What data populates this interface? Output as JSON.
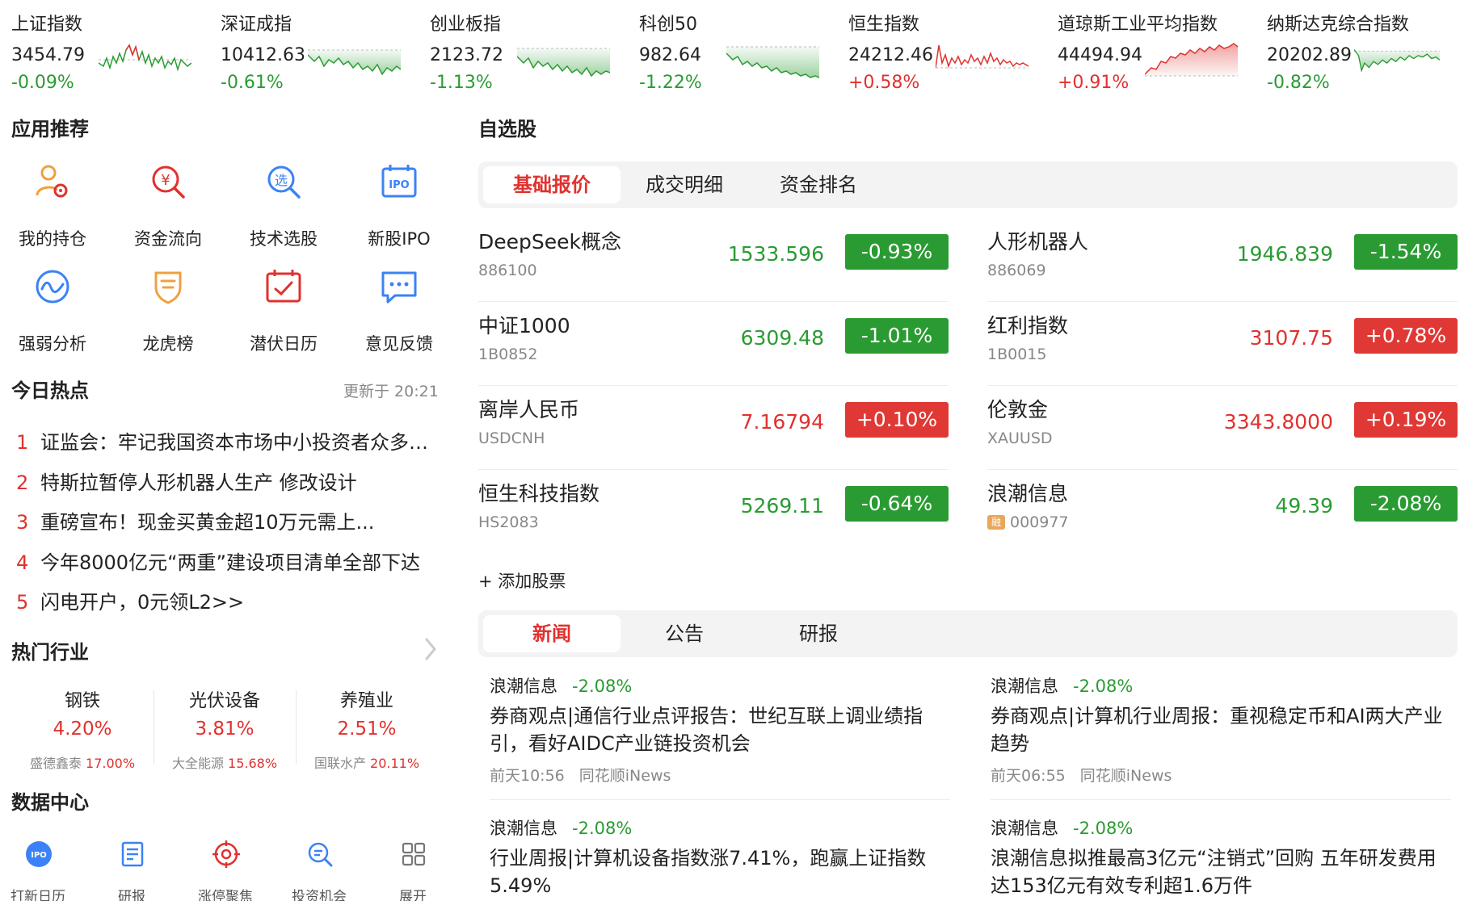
{
  "tickers": [
    {
      "name": "上证指数",
      "value": "3454.79",
      "change": "-0.09%",
      "dir": "down"
    },
    {
      "name": "深证成指",
      "value": "10412.63",
      "change": "-0.61%",
      "dir": "down"
    },
    {
      "name": "创业板指",
      "value": "2123.72",
      "change": "-1.13%",
      "dir": "down"
    },
    {
      "name": "科创50",
      "value": "982.64",
      "change": "-1.22%",
      "dir": "down"
    },
    {
      "name": "恒生指数",
      "value": "24212.46",
      "change": "+0.58%",
      "dir": "up"
    },
    {
      "name": "道琼斯工业平均指数",
      "value": "44494.94",
      "change": "+0.91%",
      "dir": "up"
    },
    {
      "name": "纳斯达克综合指数",
      "value": "20202.89",
      "change": "-0.82%",
      "dir": "down"
    }
  ],
  "apps": {
    "title": "应用推荐",
    "items": [
      {
        "label": "我的持仓",
        "icon": "portfolio-icon"
      },
      {
        "label": "资金流向",
        "icon": "money-search-icon"
      },
      {
        "label": "技术选股",
        "icon": "stock-picker-icon"
      },
      {
        "label": "新股IPO",
        "icon": "ipo-calendar-icon"
      },
      {
        "label": "强弱分析",
        "icon": "wave-analysis-icon"
      },
      {
        "label": "龙虎榜",
        "icon": "shield-badge-icon"
      },
      {
        "label": "潜伏日历",
        "icon": "check-calendar-icon"
      },
      {
        "label": "意见反馈",
        "icon": "feedback-chat-icon"
      }
    ]
  },
  "hot": {
    "title": "今日热点",
    "updated": "更新于 20:21",
    "items": [
      {
        "num": "1",
        "text": "证监会：牢记我国资本市场中小投资者众多的最大市情"
      },
      {
        "num": "2",
        "text": "特斯拉暂停人形机器人生产 修改设计"
      },
      {
        "num": "3",
        "text": "重磅宣布！现金买黄金超10万元需上..."
      },
      {
        "num": "4",
        "text": "今年8000亿元“两重”建设项目清单全部下达"
      },
      {
        "num": "5",
        "text": "闪电开户，0元领L2>>"
      }
    ]
  },
  "industries": {
    "title": "热门行业",
    "items": [
      {
        "name": "钢铁",
        "change": "4.20%",
        "leader": "盛德鑫泰",
        "leader_change": "17.00%"
      },
      {
        "name": "光伏设备",
        "change": "3.81%",
        "leader": "大全能源",
        "leader_change": "15.68%"
      },
      {
        "name": "养殖业",
        "change": "2.51%",
        "leader": "国联水产",
        "leader_change": "20.11%"
      }
    ]
  },
  "datacenter": {
    "title": "数据中心",
    "items": [
      {
        "label": "打新日历",
        "icon": "ipo-circle-icon"
      },
      {
        "label": "研报",
        "icon": "report-icon"
      },
      {
        "label": "涨停聚焦",
        "icon": "target-icon"
      },
      {
        "label": "投资机会",
        "icon": "search-opportunity-icon"
      },
      {
        "label": "展开",
        "icon": "grid-expand-icon"
      }
    ]
  },
  "watchlist": {
    "title": "自选股",
    "tabs": [
      "基础报价",
      "成交明细",
      "资金排名"
    ],
    "stocks": [
      {
        "name": "DeepSeek概念",
        "code": "886100",
        "price": "1533.596",
        "change": "-0.93%",
        "dir": "down"
      },
      {
        "name": "人形机器人",
        "code": "886069",
        "price": "1946.839",
        "change": "-1.54%",
        "dir": "down"
      },
      {
        "name": "中证1000",
        "code": "1B0852",
        "price": "6309.48",
        "change": "-1.01%",
        "dir": "down"
      },
      {
        "name": "红利指数",
        "code": "1B0015",
        "price": "3107.75",
        "change": "+0.78%",
        "dir": "up"
      },
      {
        "name": "离岸人民币",
        "code": "USDCNH",
        "price": "7.16794",
        "change": "+0.10%",
        "dir": "up"
      },
      {
        "name": "伦敦金",
        "code": "XAUUSD",
        "price": "3343.8000",
        "change": "+0.19%",
        "dir": "up"
      },
      {
        "name": "恒生科技指数",
        "code": "HS2083",
        "price": "5269.11",
        "change": "-0.64%",
        "dir": "down"
      },
      {
        "name": "浪潮信息",
        "code": "000977",
        "price": "49.39",
        "change": "-2.08%",
        "dir": "down",
        "badge": "融"
      }
    ],
    "add_label": "+ 添加股票"
  },
  "news": {
    "tabs": [
      "新闻",
      "公告",
      "研报"
    ],
    "items": [
      {
        "stock": "浪潮信息",
        "change": "-2.08%",
        "title": "券商观点|通信行业点评报告：世纪互联上调业绩指引，看好AIDC产业链投资机会",
        "time": "前天10:56",
        "source": "同花顺iNews"
      },
      {
        "stock": "浪潮信息",
        "change": "-2.08%",
        "title": "券商观点|计算机行业周报：重视稳定币和AI两大产业趋势",
        "time": "前天06:55",
        "source": "同花顺iNews"
      },
      {
        "stock": "浪潮信息",
        "change": "-2.08%",
        "title": "行业周报|计算机设备指数涨7.41%，跑赢上证指数5.49%",
        "time": "",
        "source": ""
      },
      {
        "stock": "浪潮信息",
        "change": "-2.08%",
        "title": "浪潮信息拟推最高3亿元“注销式”回购 五年研发费用达153亿元有效专利超1.6万件",
        "time": "",
        "source": ""
      }
    ]
  },
  "colors": {
    "up": "#e0312f",
    "down": "#2a9b32"
  }
}
